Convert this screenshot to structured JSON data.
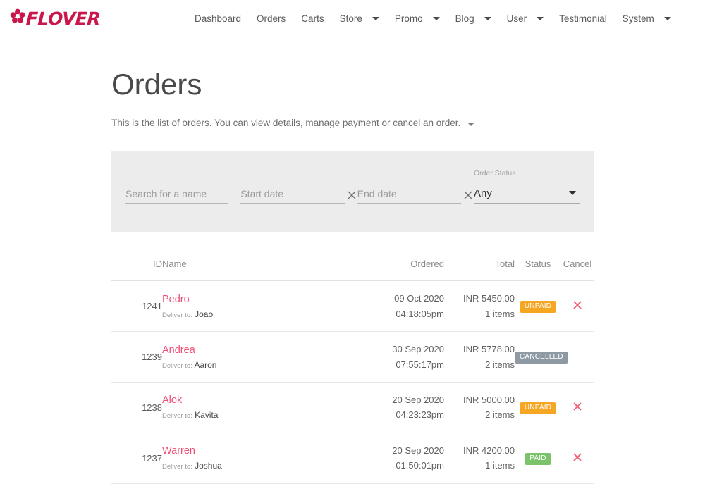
{
  "brand": {
    "name": "FLOVER",
    "icon": "flower-icon",
    "color": "#c9174b"
  },
  "nav": {
    "items": [
      {
        "label": "Dashboard",
        "has_caret": false
      },
      {
        "label": "Orders",
        "has_caret": false
      },
      {
        "label": "Carts",
        "has_caret": false
      },
      {
        "label": "Store",
        "has_caret": true
      },
      {
        "label": "Promo",
        "has_caret": true
      },
      {
        "label": "Blog",
        "has_caret": true
      },
      {
        "label": "User",
        "has_caret": true
      },
      {
        "label": "Testimonial",
        "has_caret": false
      },
      {
        "label": "System",
        "has_caret": true
      }
    ]
  },
  "page": {
    "title": "Orders",
    "description": "This is the list of orders. You can view details, manage payment or cancel an order."
  },
  "filters": {
    "search": {
      "value": "",
      "placeholder": "Search for a name"
    },
    "start_date": {
      "value": "",
      "placeholder": "Start date"
    },
    "end_date": {
      "value": "",
      "placeholder": "End date"
    },
    "order_status": {
      "label": "Order Status",
      "value": "Any"
    }
  },
  "table": {
    "columns": [
      "ID",
      "Name",
      "Ordered",
      "Total",
      "Status",
      "Cancel"
    ],
    "rows": [
      {
        "id": "1241",
        "name": "Pedro",
        "deliver_label": "Deliver to:",
        "deliver_to": "Joao",
        "date": "09 Oct 2020",
        "time": "04:18:05pm",
        "amount": "INR 5450.00",
        "items": "1 items",
        "status": "UNPAID",
        "status_kind": "unpaid",
        "status_color": "#f5a623",
        "cancellable": true
      },
      {
        "id": "1239",
        "name": "Andrea",
        "deliver_label": "Deliver to:",
        "deliver_to": "Aaron",
        "date": "30 Sep 2020",
        "time": "07:55:17pm",
        "amount": "INR 5778.00",
        "items": "2 items",
        "status": "CANCELLED",
        "status_kind": "cancelled",
        "status_color": "#8d9aa3",
        "cancellable": false
      },
      {
        "id": "1238",
        "name": "Alok",
        "deliver_label": "Deliver to:",
        "deliver_to": "Kavita",
        "date": "20 Sep 2020",
        "time": "04:23:23pm",
        "amount": "INR 5000.00",
        "items": "2 items",
        "status": "UNPAID",
        "status_kind": "unpaid",
        "status_color": "#f5a623",
        "cancellable": true
      },
      {
        "id": "1237",
        "name": "Warren",
        "deliver_label": "Deliver to:",
        "deliver_to": "Joshua",
        "date": "20 Sep 2020",
        "time": "01:50:01pm",
        "amount": "INR 4200.00",
        "items": "1 items",
        "status": "PAID",
        "status_kind": "paid",
        "status_color": "#7ac36a",
        "cancellable": true
      }
    ]
  },
  "colors": {
    "accent_pink": "#ef4f75",
    "brand_red": "#c9174b",
    "panel_bg": "#ececec",
    "cancel_icon": "#ef5a72"
  }
}
